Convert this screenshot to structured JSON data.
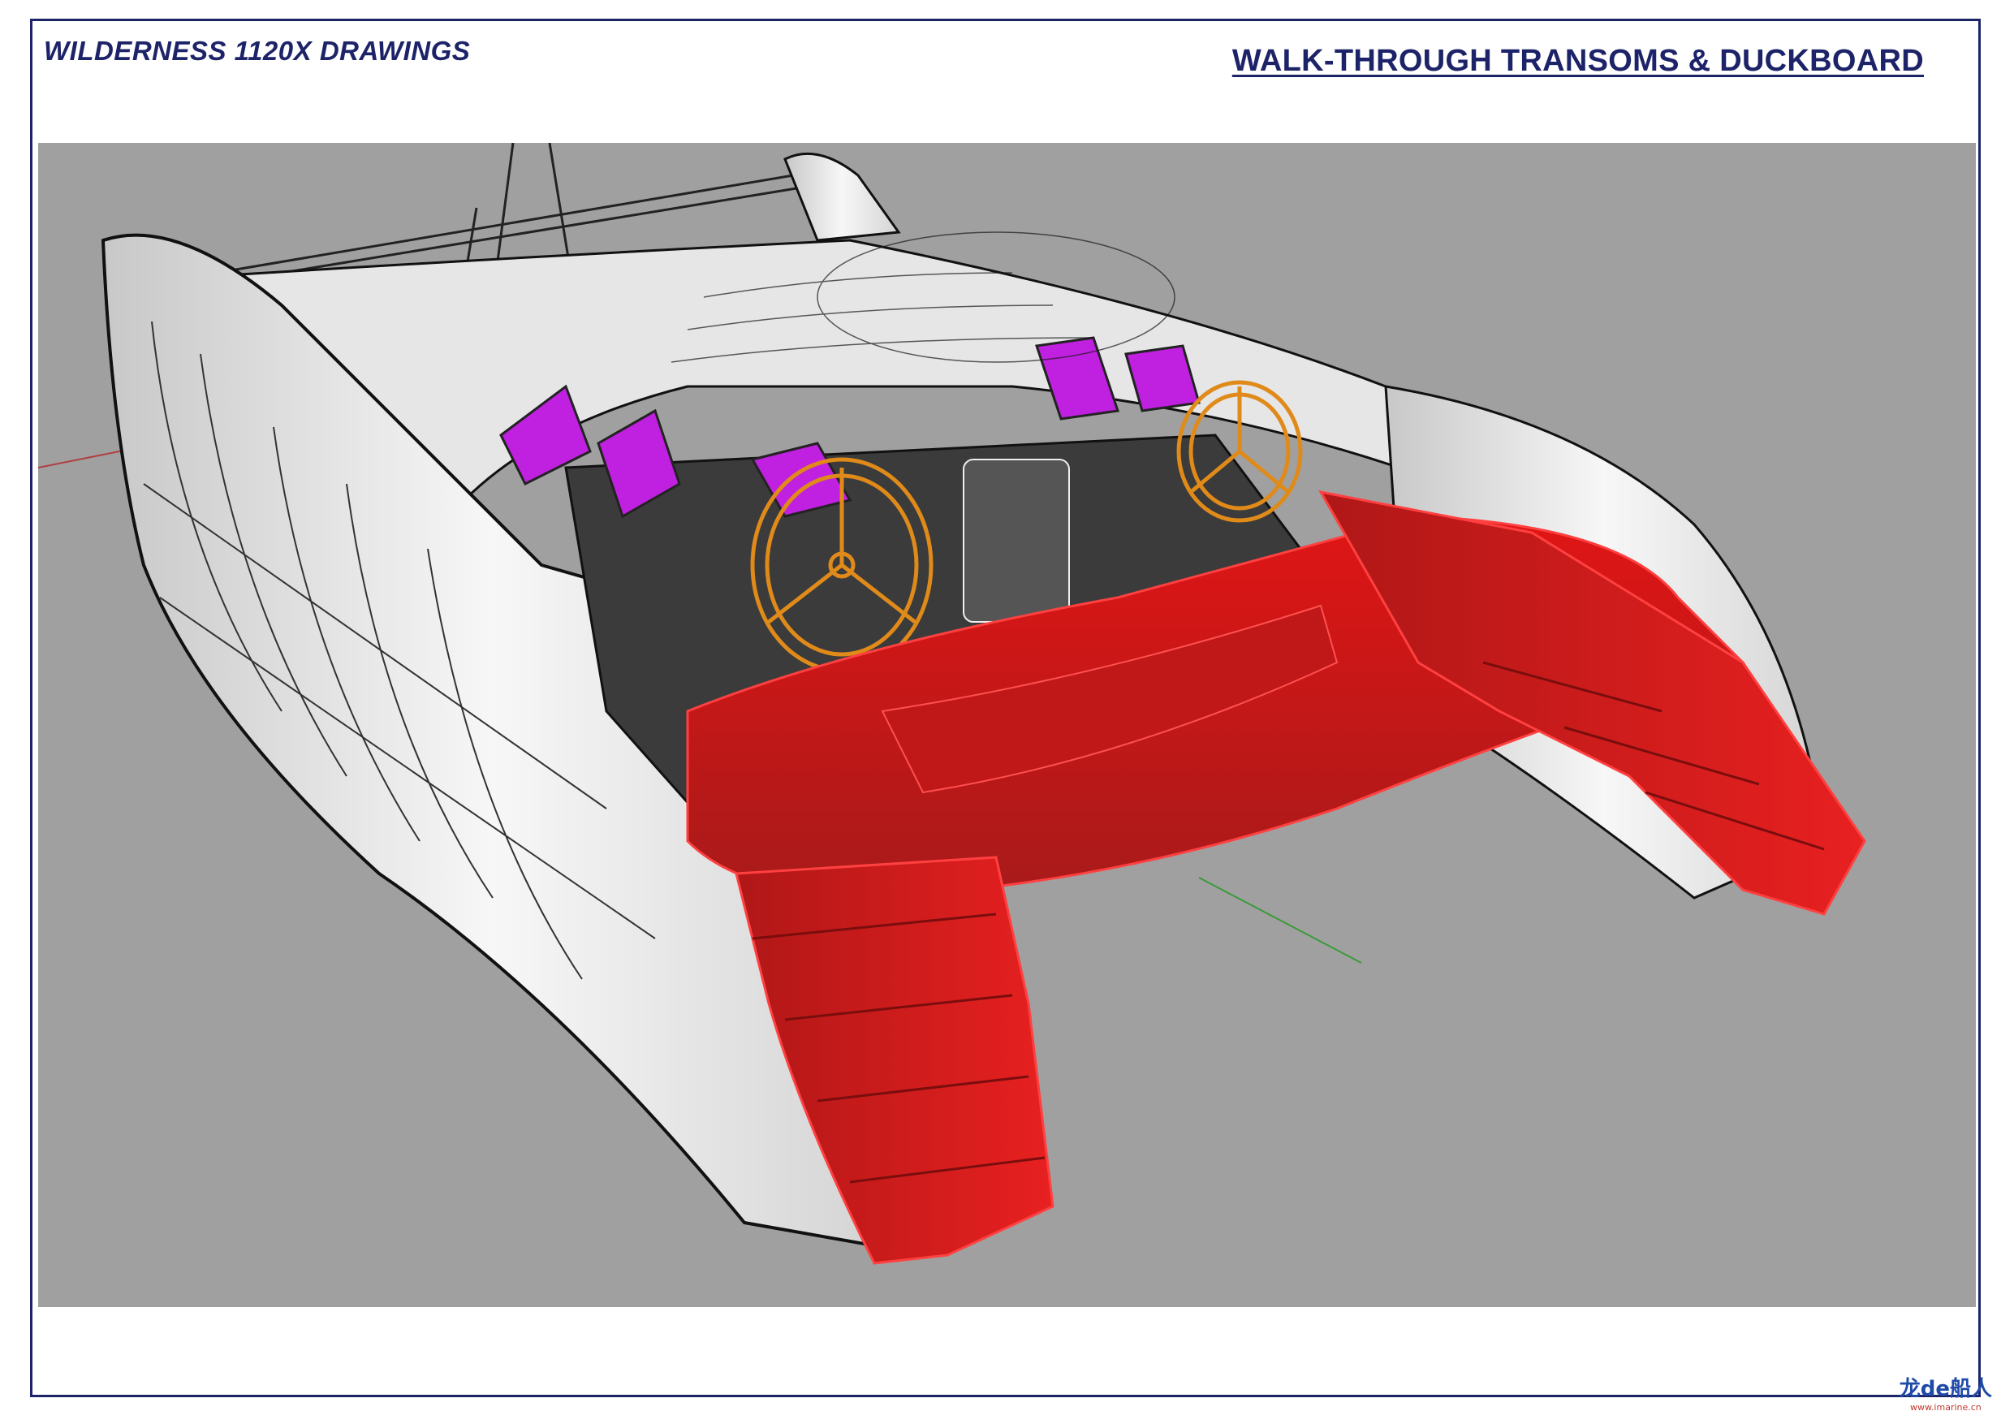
{
  "header": {
    "doc_title": "WILDERNESS 1120X DRAWINGS",
    "sheet_title": "WALK-THROUGH TRANSOMS & DUCKBOARD"
  },
  "viewport": {
    "background_color": "#a0a0a0",
    "model_colors": {
      "hull": "#f2f2f2",
      "transoms": "#e01515",
      "transoms_shade": "#a81a1a",
      "glazing": "#c020e0",
      "wheels": "#e08a1a",
      "cockpit": "#3b3b3b",
      "wireframe": "#1a1a1a"
    }
  },
  "watermark": {
    "text": "龙de船人",
    "url": "www.imarine.cn"
  }
}
